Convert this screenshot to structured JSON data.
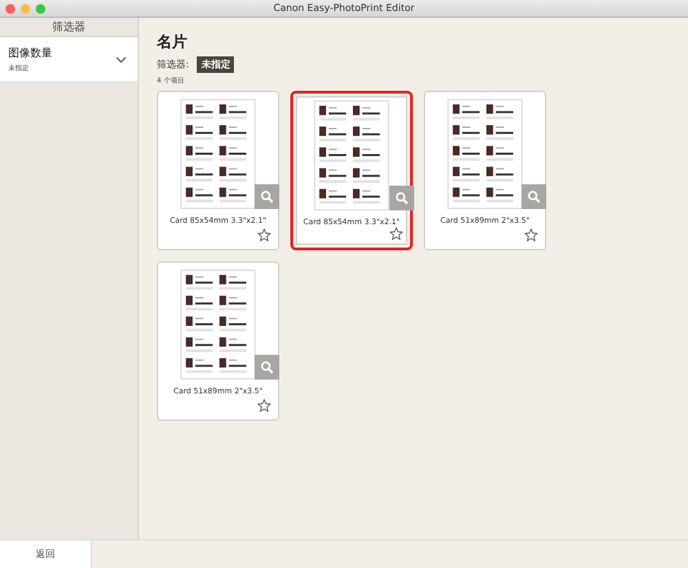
{
  "window": {
    "title": "Canon Easy-PhotoPrint Editor"
  },
  "sidebar": {
    "header": "筛选器",
    "items": [
      {
        "label": "图像数量",
        "value": "未指定",
        "expanded": false
      }
    ]
  },
  "main": {
    "title": "名片",
    "filter_label": "筛选器:",
    "filter_value": "未指定",
    "count": "4 个项目"
  },
  "cards": [
    {
      "label": "Card 85x54mm 3.3\"x2.1\"",
      "selected": false,
      "favorite": false
    },
    {
      "label": "Card 85x54mm 3.3\"x2.1\"",
      "selected": true,
      "favorite": false
    },
    {
      "label": "Card 51x89mm 2\"x3.5\"",
      "selected": false,
      "favorite": false
    },
    {
      "label": "Card 51x89mm 2\"x3.5\"",
      "selected": false,
      "favorite": false
    }
  ],
  "footer": {
    "back": "返回"
  }
}
